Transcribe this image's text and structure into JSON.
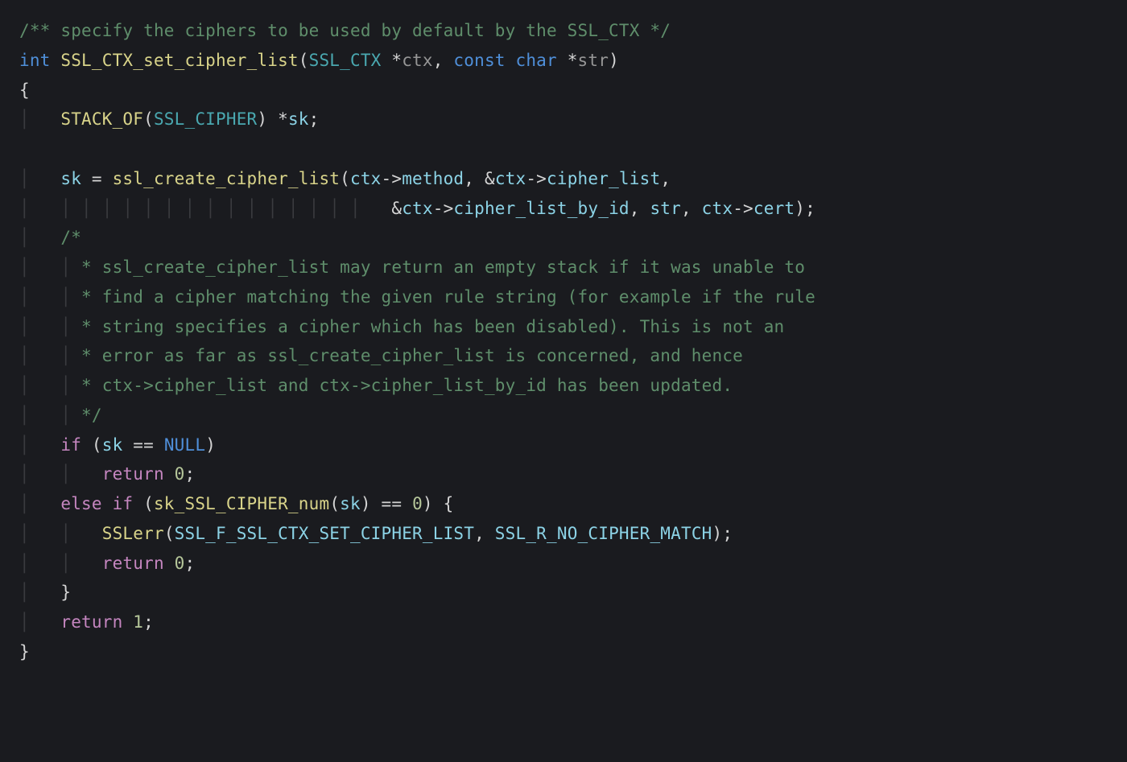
{
  "code": {
    "top_comment": "/** specify the ciphers to be used by default by the SSL_CTX */",
    "ret_type": "int",
    "func_name": "SSL_CTX_set_cipher_list",
    "param_type": "SSL_CTX",
    "param1": "ctx",
    "kw_const": "const",
    "kw_char": "char",
    "param2": "str",
    "brace_open": "{",
    "stack_of": "STACK_OF",
    "ssl_cipher": "SSL_CIPHER",
    "sk_decl": "sk",
    "assign1_lhs": "sk",
    "eq1": "=",
    "call1": "ssl_create_cipher_list",
    "a1_ctx": "ctx",
    "arrow": "->",
    "a1_method": "method",
    "amp": "&",
    "a1_cl": "cipher_list",
    "a1_clbi": "cipher_list_by_id",
    "a1_str": "str",
    "a1_cert": "cert",
    "blk_open": "/*",
    "blk_l1": " * ssl_create_cipher_list may return an empty stack if it was unable to",
    "blk_l2": " * find a cipher matching the given rule string (for example if the rule",
    "blk_l3": " * string specifies a cipher which has been disabled). This is not an",
    "blk_l4": " * error as far as ssl_create_cipher_list is concerned, and hence",
    "blk_l5": " * ctx->cipher_list and ctx->cipher_list_by_id has been updated.",
    "blk_close": " */",
    "kw_if": "if",
    "sk_var": "sk",
    "eqeq": "==",
    "null": "NULL",
    "kw_return": "return",
    "zero": "0",
    "kw_else": "else",
    "call_sknum": "sk_SSL_CIPHER_num",
    "call_sslerr": "SSLerr",
    "eflag1": "SSL_F_SSL_CTX_SET_CIPHER_LIST",
    "eflag2": "SSL_R_NO_CIPHER_MATCH",
    "one": "1",
    "brace_close": "}",
    "star": "*",
    "semi": ";",
    "comma": ",",
    "lparen": "(",
    "rparen": ")"
  }
}
